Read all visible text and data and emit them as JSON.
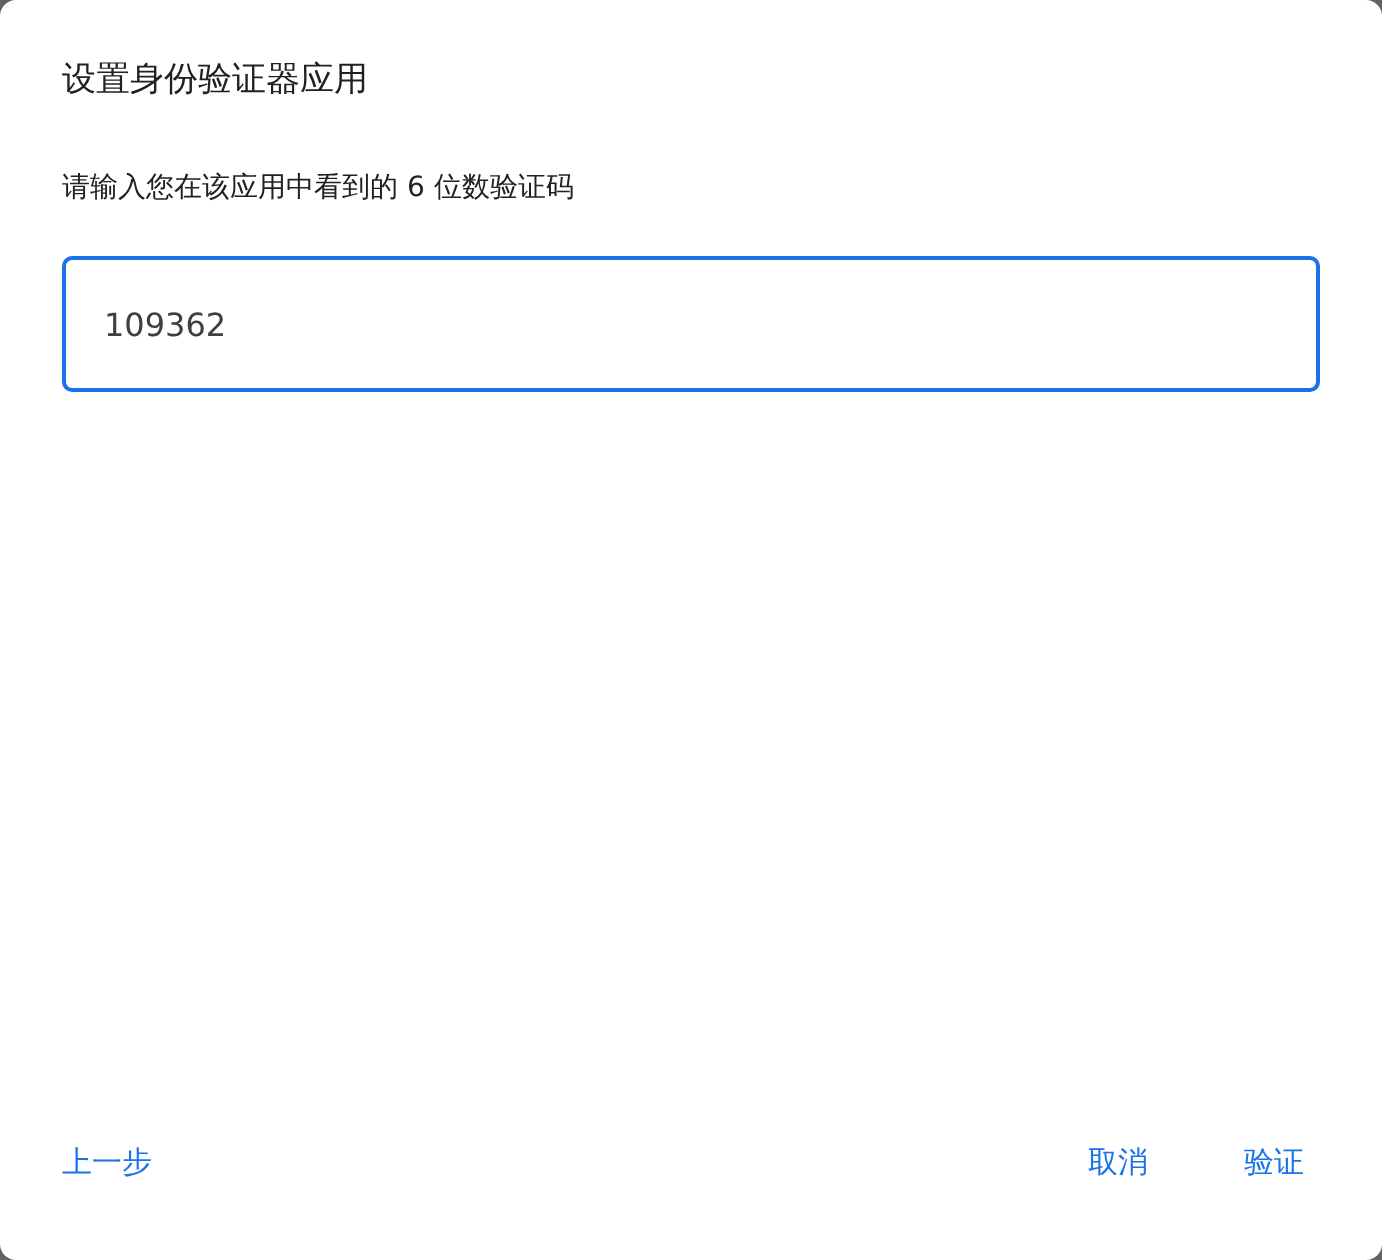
{
  "dialog": {
    "title": "设置身份验证器应用",
    "prompt": "请输入您在该应用中看到的 6 位数验证码"
  },
  "code_field": {
    "value": "109362",
    "focused": true
  },
  "buttons": {
    "back": "上一步",
    "cancel": "取消",
    "verify": "验证"
  }
}
